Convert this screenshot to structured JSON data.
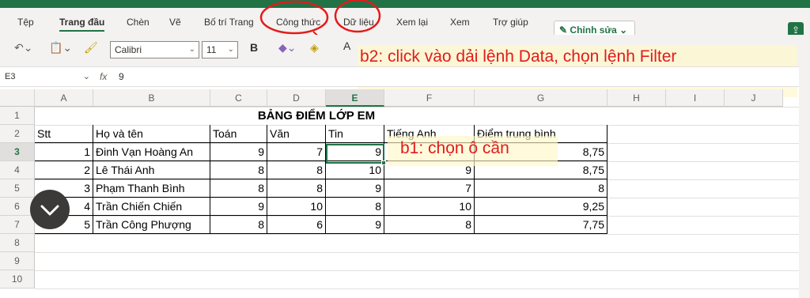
{
  "ribbon": {
    "tabs": [
      {
        "label": "Tệp"
      },
      {
        "label": "Trang đầu"
      },
      {
        "label": "Chèn"
      },
      {
        "label": "Vẽ"
      },
      {
        "label": "Bố trí Trang"
      },
      {
        "label": "Công thức"
      },
      {
        "label": "Dữ liệu"
      },
      {
        "label": "Xem lại"
      },
      {
        "label": "Xem"
      },
      {
        "label": "Trợ giúp"
      }
    ],
    "edit_label": "Chỉnh sửa",
    "accent_color": "#217346"
  },
  "toolbar": {
    "font_name": "Calibri",
    "font_size": "11",
    "bold_label": "B",
    "icons": [
      "undo-icon",
      "paste-icon",
      "format-painter-icon",
      "eraser-icon",
      "fill-color-icon",
      "font-color-icon"
    ]
  },
  "annotations": {
    "b2": "b2: click vào dải lệnh Data, chọn lệnh Filter",
    "b1": "b1: chọn ô cần",
    "color": "#e21b1b"
  },
  "formula_bar": {
    "name_box": "E3",
    "fx": "fx",
    "value": "9"
  },
  "grid": {
    "columns": [
      "A",
      "B",
      "C",
      "D",
      "E",
      "F",
      "G",
      "H",
      "I",
      "J"
    ],
    "selected_column": "E",
    "rows": [
      "1",
      "2",
      "3",
      "4",
      "5",
      "6",
      "7",
      "8",
      "9",
      "10"
    ],
    "selected_row": "3",
    "title": "BẢNG ĐIỂM LỚP EM",
    "headers": [
      "Stt",
      "Họ và tên",
      "Toán",
      "Văn",
      "Tin",
      "Tiếng Anh",
      "Điểm trung bình"
    ],
    "data": [
      [
        "1",
        "Đinh Vạn Hoàng An",
        "9",
        "7",
        "9",
        "",
        "8,75"
      ],
      [
        "2",
        "Lê Thái Anh",
        "8",
        "8",
        "10",
        "9",
        "8,75"
      ],
      [
        "3",
        "Phạm Thanh Bình",
        "8",
        "8",
        "9",
        "7",
        "8"
      ],
      [
        "4",
        "Trần Chiến Chiến",
        "9",
        "10",
        "8",
        "10",
        "9,25"
      ],
      [
        "5",
        "Trần Công Phượng",
        "8",
        "6",
        "9",
        "8",
        "7,75"
      ]
    ]
  }
}
